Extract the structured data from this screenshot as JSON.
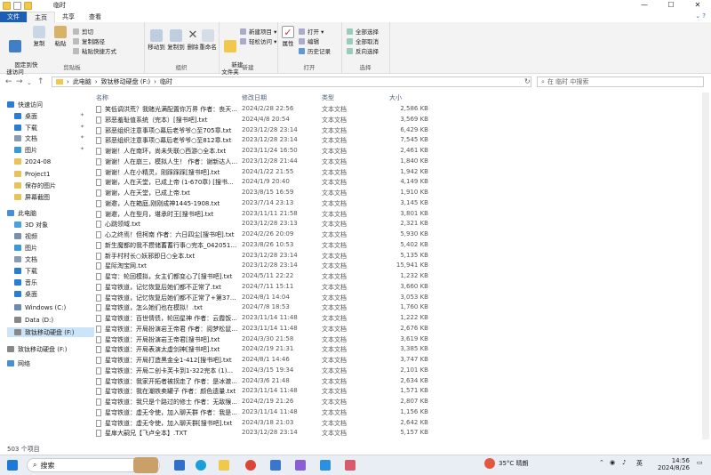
{
  "window": {
    "title": "临时",
    "controls": [
      "—",
      "☐",
      "✕"
    ]
  },
  "ribbon_tabs": [
    "文件",
    "主页",
    "共享",
    "查看"
  ],
  "ribbon": {
    "clipboard": {
      "pin_label": "固定到快\n速访问",
      "copy_label": "复制",
      "paste_label": "粘贴",
      "cut": "剪切",
      "copy_path": "复制路径",
      "paste_shortcut": "粘贴快捷方式",
      "group_label": "剪贴板"
    },
    "organize": {
      "move_to": "移动到",
      "copy_to": "复制到",
      "delete": "删除",
      "rename": "重命名",
      "group_label": "组织"
    },
    "new": {
      "new_folder": "新建\n文件夹",
      "new_item": "新建项目 ▾",
      "easy_access": "轻松访问 ▾",
      "group_label": "新建"
    },
    "open": {
      "properties": "属性",
      "open": "打开 ▾",
      "edit": "编辑",
      "history": "历史记录",
      "group_label": "打开"
    },
    "select": {
      "select_all": "全部选择",
      "select_none": "全部取消",
      "invert": "反向选择",
      "group_label": "选择"
    }
  },
  "address": {
    "path": [
      "此电脑",
      "致钛移动硬盘 (F:)",
      "临时"
    ],
    "search_placeholder": "在 临时 中搜索"
  },
  "nav": {
    "items": [
      {
        "label": "快速访问",
        "color": "#2b7cd3",
        "indent": 0,
        "pinned": false
      },
      {
        "label": "桌面",
        "color": "#2b7cd3",
        "indent": 1,
        "pinned": true
      },
      {
        "label": "下载",
        "color": "#2b7cd3",
        "indent": 1,
        "pinned": true
      },
      {
        "label": "文档",
        "color": "#8a9bb0",
        "indent": 1,
        "pinned": true
      },
      {
        "label": "图片",
        "color": "#3a9ad9",
        "indent": 1,
        "pinned": true
      },
      {
        "label": "2024-08",
        "color": "#e8c25a",
        "indent": 1,
        "pinned": false
      },
      {
        "label": "Project1",
        "color": "#e8c25a",
        "indent": 1,
        "pinned": false
      },
      {
        "label": "保存的图片",
        "color": "#e8c25a",
        "indent": 1,
        "pinned": false
      },
      {
        "label": "屏幕截图",
        "color": "#e8c25a",
        "indent": 1,
        "pinned": false
      },
      {
        "label": "此电脑",
        "color": "#4a8fd4",
        "indent": 0,
        "pinned": false
      },
      {
        "label": "3D 对象",
        "color": "#4aa0e0",
        "indent": 1,
        "pinned": false
      },
      {
        "label": "视频",
        "color": "#7a8fa8",
        "indent": 1,
        "pinned": false
      },
      {
        "label": "图片",
        "color": "#3a9ad9",
        "indent": 1,
        "pinned": false
      },
      {
        "label": "文档",
        "color": "#8a9bb0",
        "indent": 1,
        "pinned": false
      },
      {
        "label": "下载",
        "color": "#2b7cd3",
        "indent": 1,
        "pinned": false
      },
      {
        "label": "音乐",
        "color": "#2b7cd3",
        "indent": 1,
        "pinned": false
      },
      {
        "label": "桌面",
        "color": "#2b7cd3",
        "indent": 1,
        "pinned": false
      },
      {
        "label": "Windows (C:)",
        "color": "#6c8ab0",
        "indent": 1,
        "pinned": false
      },
      {
        "label": "Data (D:)",
        "color": "#888888",
        "indent": 1,
        "pinned": false
      },
      {
        "label": "致钛移动硬盘 (F:)",
        "color": "#888888",
        "indent": 1,
        "pinned": false,
        "selected": true
      },
      {
        "label": "致钛移动硬盘 (F:)",
        "color": "#888888",
        "indent": 0,
        "pinned": false
      },
      {
        "label": "网络",
        "color": "#4a8fd4",
        "indent": 0,
        "pinned": false
      }
    ]
  },
  "columns": {
    "name": "名称",
    "date": "修改日期",
    "type": "类型",
    "size": "大小"
  },
  "files": [
    {
      "name": "笑低调洪荒？我赌光满配置你万界 作者：丧天...",
      "date": "2024/2/28 22:56",
      "type": "文本文档",
      "size": "2,586 KB"
    },
    {
      "name": "邪恶羞耻值系统（完本）[搜书吧].txt",
      "date": "2024/4/8 20:54",
      "type": "文本文档",
      "size": "3,569 KB"
    },
    {
      "name": "邪恶组织注意事项○幕后老爷爷○至705章.txt",
      "date": "2023/12/28 23:14",
      "type": "文本文档",
      "size": "6,429 KB"
    },
    {
      "name": "邪恶组织注意事项○幕后老爷爷○至812章.txt",
      "date": "2023/12/28 23:14",
      "type": "文本文档",
      "size": "7,545 KB"
    },
    {
      "name": "谢谢！人在南环，尚未失联○西游○全本.txt",
      "date": "2023/11/24 16:50",
      "type": "文本文档",
      "size": "2,461 KB"
    },
    {
      "name": "谢谢！人在崩三，模拟人生！ 作者：谢新达人 ...",
      "date": "2023/12/28 21:44",
      "type": "文本文档",
      "size": "1,840 KB"
    },
    {
      "name": "谢谢！人在小精灵，刚踩踩踩[搜书吧].txt",
      "date": "2024/1/22 21:55",
      "type": "文本文档",
      "size": "1,942 KB"
    },
    {
      "name": "谢谢，人在天堂，已成上帝 (1-670章) [搜书...",
      "date": "2024/1/9 20:40",
      "type": "文本文档",
      "size": "4,149 KB"
    },
    {
      "name": "谢谢，人在天堂，已成上帝.txt",
      "date": "2023/8/15 16:59",
      "type": "文本文档",
      "size": "1,910 KB"
    },
    {
      "name": "谢邀，人在箱庭,刚刚成神1445-1908.txt",
      "date": "2023/7/14 23:13",
      "type": "文本文档",
      "size": "3,145 KB"
    },
    {
      "name": "谢邀，人在型月，堪承时王[搜书吧].txt",
      "date": "2023/11/11 21:58",
      "type": "文本文档",
      "size": "3,801 KB"
    },
    {
      "name": "心跳领域.txt",
      "date": "2023/12/28 23:13",
      "type": "文本文档",
      "size": "2,321 KB"
    },
    {
      "name": "心之终焉！但柯南 作者：六日四尘[搜书吧].txt",
      "date": "2024/2/26 20:09",
      "type": "文本文档",
      "size": "5,930 KB"
    },
    {
      "name": "新生魔都的我不攒储蓄蓄行事○完本_042051.txt",
      "date": "2023/8/26 10:53",
      "type": "文本文档",
      "size": "5,402 KB"
    },
    {
      "name": "新手村村长○妖邪即日○全本.txt",
      "date": "2023/12/28 23:14",
      "type": "文本文档",
      "size": "5,135 KB"
    },
    {
      "name": "星际淘宝网.txt",
      "date": "2023/12/28 23:14",
      "type": "文本文档",
      "size": "15,941 KB"
    },
    {
      "name": "星穹：轮回模拟，女主们都变心了[搜书吧].txt",
      "date": "2024/5/11 22:22",
      "type": "文本文档",
      "size": "1,232 KB"
    },
    {
      "name": "星穹铁道，记忆恢复后她们都不正常了.txt",
      "date": "2024/7/11 15:11",
      "type": "文本文档",
      "size": "3,660 KB"
    },
    {
      "name": "星穹铁道，记忆恢复后她们都不正常了+第373...",
      "date": "2024/8/1 14:04",
      "type": "文本文档",
      "size": "3,053 KB"
    },
    {
      "name": "星穹铁道，怎么她们也在模拟！.txt",
      "date": "2024/7/8 18:53",
      "type": "文本文档",
      "size": "1,760 KB"
    },
    {
      "name": "星穹铁道：百世情债，轮回星神 作者：云霞饭...",
      "date": "2023/11/14 11:48",
      "type": "文本文档",
      "size": "1,222 KB"
    },
    {
      "name": "星穹铁道：开局扮演岩王帝君 作者：阅梦松鼠t...",
      "date": "2023/11/14 11:48",
      "type": "文本文档",
      "size": "2,676 KB"
    },
    {
      "name": "星穹铁道：开局扮演岩王帝君[搜书吧].txt",
      "date": "2024/3/30 21:58",
      "type": "文本文档",
      "size": "3,619 KB"
    },
    {
      "name": "星穹铁道：开局表演太虚剑神[搜书吧].txt",
      "date": "2024/2/19 21:31",
      "type": "文本文档",
      "size": "3,385 KB"
    },
    {
      "name": "星穹铁道：开局打造黑金全1-412[搜书吧].txt",
      "date": "2024/8/1 14:46",
      "type": "文本文档",
      "size": "3,747 KB"
    },
    {
      "name": "星穹铁道：开局二创卡芙卡到1-322完本 (1)...",
      "date": "2024/3/15 19:34",
      "type": "文本文档",
      "size": "2,101 KB"
    },
    {
      "name": "星穹铁道：我家开拓者被拐走了 作者：是冰澈...",
      "date": "2024/3/6 21:48",
      "type": "文本文档",
      "size": "2,634 KB"
    },
    {
      "name": "星穹铁道：我在潮铁卖罐子 作者：颜色遗量.txt",
      "date": "2023/11/14 11:48",
      "type": "文本文档",
      "size": "1,571 KB"
    },
    {
      "name": "星穹铁道：我只是个路过的修士 作者：无敌猴...",
      "date": "2024/2/19 21:26",
      "type": "文本文档",
      "size": "2,807 KB"
    },
    {
      "name": "星穹铁道：虚无令使，加入聊天群 作者：我是...",
      "date": "2023/11/14 11:48",
      "type": "文本文档",
      "size": "1,156 KB"
    },
    {
      "name": "星穹铁道：虚无令使，加入聊天群[搜书吧].txt",
      "date": "2024/3/18 21:03",
      "type": "文本文档",
      "size": "2,642 KB"
    },
    {
      "name": "星扉大嗣兄【飞卢全本】.TXT",
      "date": "2023/12/28 23:14",
      "type": "文本文档",
      "size": "5,157 KB"
    }
  ],
  "status": {
    "count": "503 个项目"
  },
  "taskbar": {
    "search_label": "搜索",
    "weather": "35°C 晴朗",
    "ime": "英",
    "time": "14:56",
    "date": "2024/8/26"
  }
}
